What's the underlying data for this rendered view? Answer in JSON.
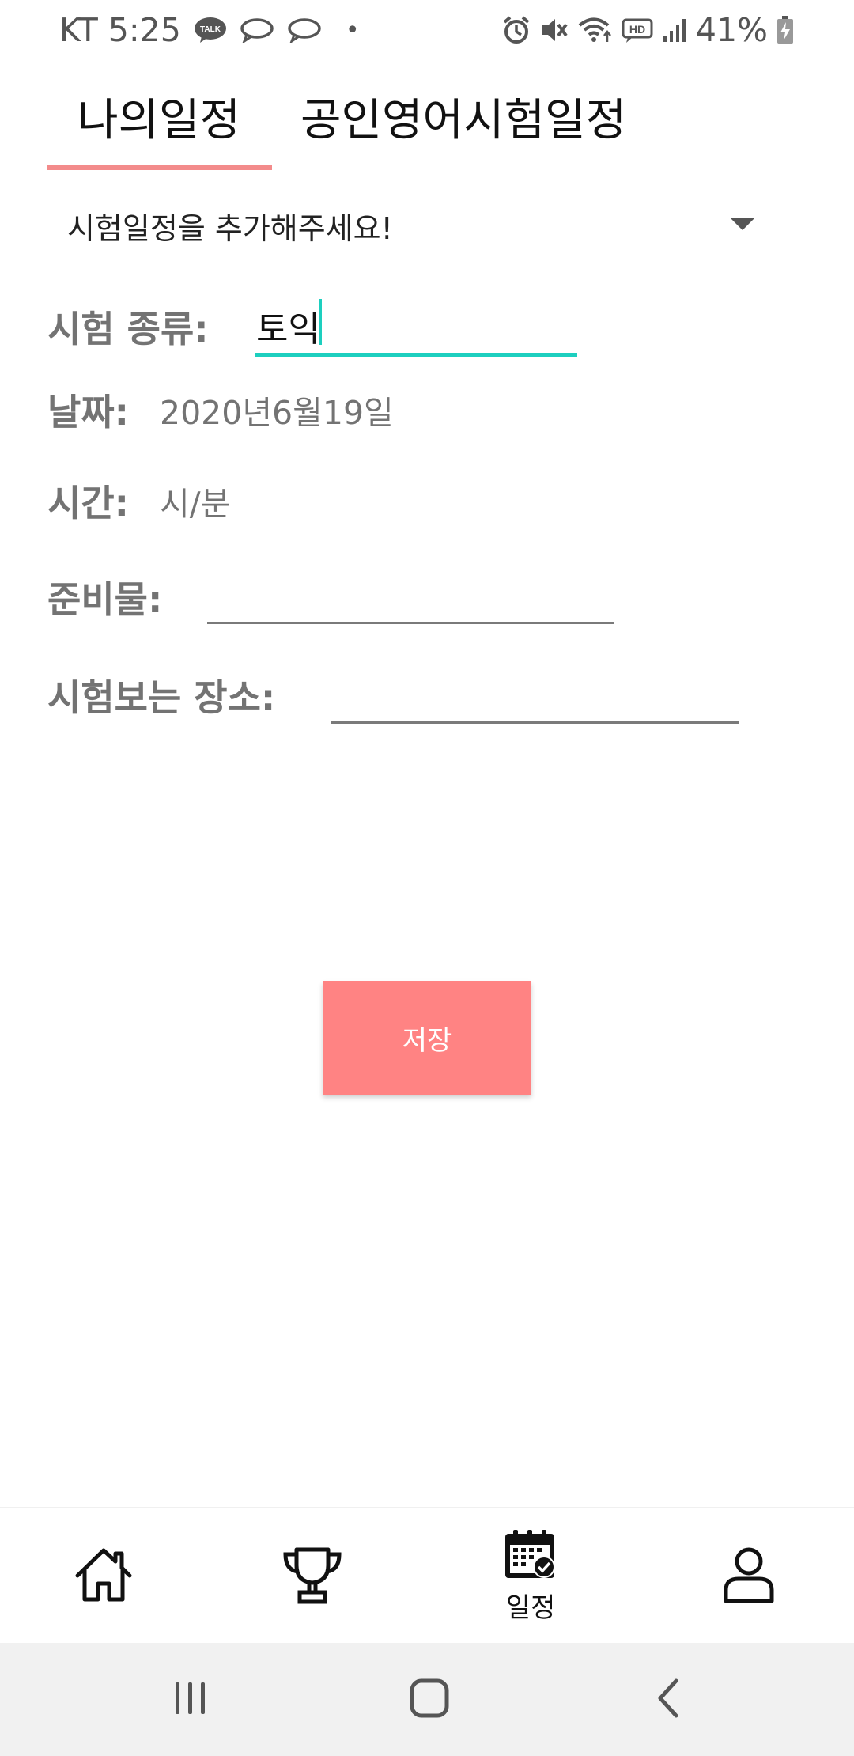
{
  "status_bar": {
    "carrier_time": "KT 5:25",
    "dot": "•",
    "battery_percent": "41%",
    "talk_badge": "TALK",
    "hd_badge": "HD"
  },
  "tabs": [
    {
      "label": "나의일정",
      "selected": true
    },
    {
      "label": "공인영어시험일정",
      "selected": false
    }
  ],
  "spinner": {
    "selected_text": "시험일정을 추가해주세요!"
  },
  "form": {
    "exam_type": {
      "label": "시험 종류:",
      "value": "토익"
    },
    "date": {
      "label": "날짜:",
      "value": "2020년6월19일"
    },
    "time": {
      "label": "시간:",
      "value": "시/분"
    },
    "supplies": {
      "label": "준비물:",
      "value": ""
    },
    "location": {
      "label": "시험보는 장소:",
      "value": ""
    }
  },
  "save_button": {
    "label": "저장"
  },
  "bottom_nav": {
    "items": [
      {
        "icon": "home-icon",
        "label": ""
      },
      {
        "icon": "trophy-icon",
        "label": ""
      },
      {
        "icon": "calendar-icon",
        "label": "일정"
      },
      {
        "icon": "profile-icon",
        "label": ""
      }
    ]
  },
  "colors": {
    "accent_pink": "#ff8383",
    "tab_indicator": "#f38b8b",
    "input_active": "#1dcfbf",
    "label_gray": "#737373"
  }
}
